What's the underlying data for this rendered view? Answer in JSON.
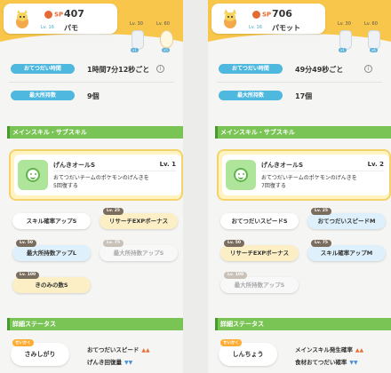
{
  "left": {
    "header": {
      "sp_label": "SP",
      "sp_value": "407",
      "level": "Lv. 16",
      "name": "パモ"
    },
    "items": [
      {
        "level": "Lv. 30",
        "count": "x1"
      },
      {
        "level": "Lv. 60",
        "count": "x5"
      }
    ],
    "help_time": {
      "label": "おてつだい時間",
      "value": "1時間7分12秒ごと"
    },
    "max_carry": {
      "label": "最大所持数",
      "value": "9個"
    },
    "section_skills": "メインスキル・サブスキル",
    "main_skill": {
      "name": "げんきオールS",
      "level": "Lv. 1",
      "desc": "おてつだいチームのポケモンのげんきを5回復する"
    },
    "subskills": [
      {
        "label": "スキル確率アップS",
        "tag": ""
      },
      {
        "label": "リサーチEXPボーナス",
        "tag": "Lv. 25"
      },
      {
        "label": "最大所持数アップL",
        "tag": "Lv. 50"
      },
      {
        "label": "最大所持数アップS",
        "tag": "Lv. 75"
      },
      {
        "label": "きのみの数S",
        "tag": "Lv. 100"
      }
    ],
    "section_status": "詳細ステータス",
    "nature": {
      "tag": "せいかく",
      "name": "さみしがり"
    },
    "effects": [
      {
        "label": "おてつだいスピード",
        "dir": "▲▲"
      },
      {
        "label": "げんき回復量",
        "dir": "▼▼"
      }
    ]
  },
  "right": {
    "header": {
      "sp_label": "SP",
      "sp_value": "706",
      "level": "Lv. 16",
      "name": "パモット"
    },
    "items": [
      {
        "level": "Lv. 30",
        "count": "x1"
      },
      {
        "level": "Lv. 60",
        "count": "x6"
      }
    ],
    "help_time": {
      "label": "おてつだい時間",
      "value": "49分49秒ごと"
    },
    "max_carry": {
      "label": "最大所持数",
      "value": "17個"
    },
    "section_skills": "メインスキル・サブスキル",
    "main_skill": {
      "name": "げんきオールS",
      "level": "Lv. 2",
      "desc": "おてつだいチームのポケモンのげんきを7回復する"
    },
    "subskills": [
      {
        "label": "おてつだいスピードS",
        "tag": ""
      },
      {
        "label": "おてつだいスピードM",
        "tag": "Lv. 25"
      },
      {
        "label": "リサーチEXPボーナス",
        "tag": "Lv. 50"
      },
      {
        "label": "スキル確率アップM",
        "tag": "Lv. 75"
      },
      {
        "label": "最大所持数アップS",
        "tag": "Lv. 100"
      }
    ],
    "section_status": "詳細ステータス",
    "nature": {
      "tag": "せいかく",
      "name": "しんちょう"
    },
    "effects": [
      {
        "label": "メインスキル発生確率",
        "dir": "▲▲"
      },
      {
        "label": "食材おてつだい確率",
        "dir": "▼▼"
      }
    ]
  },
  "shared": {
    "info_icon": "i"
  }
}
